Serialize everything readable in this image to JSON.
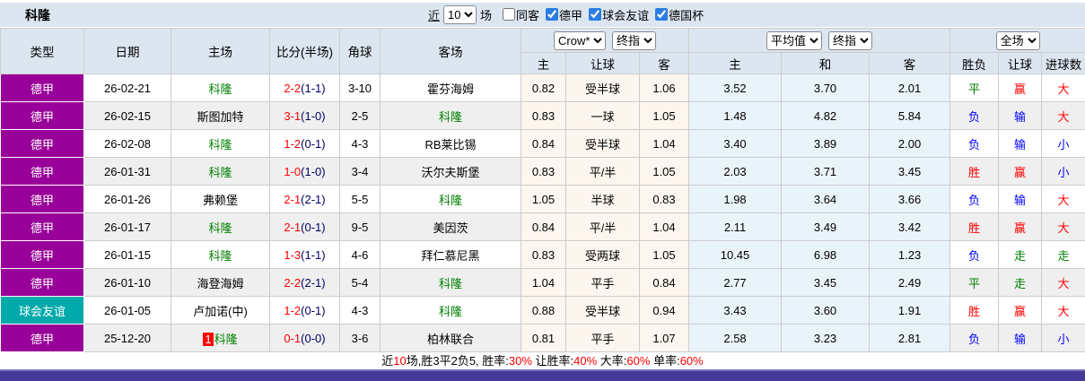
{
  "colors": {
    "bundesliga": "#990099",
    "friendly": "#00AAAA",
    "header_bg": "#dce6f1",
    "cream": "#fdf6ee",
    "light_blue": "#e9f3fa",
    "stripe": "#efefef",
    "red": "#ff0000",
    "blue": "#0000ff",
    "green": "#008000",
    "half_navy": "#000066",
    "checkbox_blue": "#2a7de1",
    "bar_purple": "#45399a"
  },
  "title": "科隆",
  "filter": {
    "near_label": "近",
    "count_value": "10",
    "count_suffix": "场",
    "checkboxes": [
      {
        "label": "同客",
        "checked": false
      },
      {
        "label": "德甲",
        "checked": true
      },
      {
        "label": "球会友谊",
        "checked": true
      },
      {
        "label": "德国杯",
        "checked": true
      }
    ]
  },
  "header": {
    "type": "类型",
    "date": "日期",
    "home": "主场",
    "score": "比分(半场)",
    "corner": "角球",
    "away": "客场",
    "selects": {
      "bookmaker": "Crow*",
      "odds_stage": "终指",
      "average": "平均值",
      "avg_stage": "终指",
      "scope": "全场"
    },
    "sub": {
      "home": "主",
      "handicap": "让球",
      "away": "客",
      "avg_home": "主",
      "avg_draw": "和",
      "avg_away": "客",
      "result": "胜负",
      "handicap_result": "让球",
      "goals": "进球数"
    }
  },
  "rows": [
    {
      "league": "德甲",
      "league_key": "bundesliga",
      "date": "26-02-21",
      "home": {
        "name": "科隆",
        "team": true
      },
      "score": {
        "ft": "2-2",
        "ht": "(1-1)"
      },
      "corners": "3-10",
      "away": {
        "name": "霍芬海姆",
        "team": false
      },
      "crown": [
        "0.82",
        "受半球",
        "1.06"
      ],
      "avg": [
        "3.52",
        "3.70",
        "2.01"
      ],
      "outcome": [
        {
          "t": "平",
          "c": "green"
        },
        {
          "t": "赢",
          "c": "red"
        },
        {
          "t": "大",
          "c": "red"
        }
      ]
    },
    {
      "league": "德甲",
      "league_key": "bundesliga",
      "date": "26-02-15",
      "home": {
        "name": "斯图加特",
        "team": false
      },
      "score": {
        "ft": "3-1",
        "ht": "(1-0)"
      },
      "corners": "2-5",
      "away": {
        "name": "科隆",
        "team": true
      },
      "crown": [
        "0.83",
        "一球",
        "1.05"
      ],
      "avg": [
        "1.48",
        "4.82",
        "5.84"
      ],
      "outcome": [
        {
          "t": "负",
          "c": "blue"
        },
        {
          "t": "输",
          "c": "blue"
        },
        {
          "t": "大",
          "c": "red"
        }
      ]
    },
    {
      "league": "德甲",
      "league_key": "bundesliga",
      "date": "26-02-08",
      "home": {
        "name": "科隆",
        "team": true
      },
      "score": {
        "ft": "1-2",
        "ht": "(0-1)"
      },
      "corners": "4-3",
      "away": {
        "name": "RB莱比锡",
        "team": false
      },
      "crown": [
        "0.84",
        "受半球",
        "1.04"
      ],
      "avg": [
        "3.40",
        "3.89",
        "2.00"
      ],
      "outcome": [
        {
          "t": "负",
          "c": "blue"
        },
        {
          "t": "输",
          "c": "blue"
        },
        {
          "t": "小",
          "c": "blue"
        }
      ]
    },
    {
      "league": "德甲",
      "league_key": "bundesliga",
      "date": "26-01-31",
      "home": {
        "name": "科隆",
        "team": true
      },
      "score": {
        "ft": "1-0",
        "ht": "(1-0)"
      },
      "corners": "3-4",
      "away": {
        "name": "沃尔夫斯堡",
        "team": false
      },
      "crown": [
        "0.83",
        "平/半",
        "1.05"
      ],
      "avg": [
        "2.03",
        "3.71",
        "3.45"
      ],
      "outcome": [
        {
          "t": "胜",
          "c": "red"
        },
        {
          "t": "赢",
          "c": "red"
        },
        {
          "t": "小",
          "c": "blue"
        }
      ]
    },
    {
      "league": "德甲",
      "league_key": "bundesliga",
      "date": "26-01-26",
      "home": {
        "name": "弗赖堡",
        "team": false
      },
      "score": {
        "ft": "2-1",
        "ht": "(2-1)"
      },
      "corners": "5-5",
      "away": {
        "name": "科隆",
        "team": true
      },
      "crown": [
        "1.05",
        "半球",
        "0.83"
      ],
      "avg": [
        "1.98",
        "3.64",
        "3.66"
      ],
      "outcome": [
        {
          "t": "负",
          "c": "blue"
        },
        {
          "t": "输",
          "c": "blue"
        },
        {
          "t": "大",
          "c": "red"
        }
      ]
    },
    {
      "league": "德甲",
      "league_key": "bundesliga",
      "date": "26-01-17",
      "home": {
        "name": "科隆",
        "team": true
      },
      "score": {
        "ft": "2-1",
        "ht": "(0-1)"
      },
      "corners": "9-5",
      "away": {
        "name": "美因茨",
        "team": false
      },
      "crown": [
        "0.84",
        "平/半",
        "1.04"
      ],
      "avg": [
        "2.11",
        "3.49",
        "3.42"
      ],
      "outcome": [
        {
          "t": "胜",
          "c": "red"
        },
        {
          "t": "赢",
          "c": "red"
        },
        {
          "t": "大",
          "c": "red"
        }
      ]
    },
    {
      "league": "德甲",
      "league_key": "bundesliga",
      "date": "26-01-15",
      "home": {
        "name": "科隆",
        "team": true
      },
      "score": {
        "ft": "1-3",
        "ht": "(1-1)"
      },
      "corners": "4-6",
      "away": {
        "name": "拜仁慕尼黑",
        "team": false
      },
      "crown": [
        "0.83",
        "受两球",
        "1.05"
      ],
      "avg": [
        "10.45",
        "6.98",
        "1.23"
      ],
      "outcome": [
        {
          "t": "负",
          "c": "blue"
        },
        {
          "t": "走",
          "c": "green"
        },
        {
          "t": "走",
          "c": "green"
        }
      ]
    },
    {
      "league": "德甲",
      "league_key": "bundesliga",
      "date": "26-01-10",
      "home": {
        "name": "海登海姆",
        "team": false
      },
      "score": {
        "ft": "2-2",
        "ht": "(2-1)"
      },
      "corners": "5-4",
      "away": {
        "name": "科隆",
        "team": true
      },
      "crown": [
        "1.04",
        "平手",
        "0.84"
      ],
      "avg": [
        "2.77",
        "3.45",
        "2.49"
      ],
      "outcome": [
        {
          "t": "平",
          "c": "green"
        },
        {
          "t": "走",
          "c": "green"
        },
        {
          "t": "大",
          "c": "red"
        }
      ]
    },
    {
      "league": "球会友谊",
      "league_key": "friendly",
      "date": "26-01-05",
      "home": {
        "name": "卢加诺(中)",
        "team": false
      },
      "score": {
        "ft": "1-2",
        "ht": "(0-1)"
      },
      "corners": "4-3",
      "away": {
        "name": "科隆",
        "team": true
      },
      "crown": [
        "0.88",
        "受半球",
        "0.94"
      ],
      "avg": [
        "3.43",
        "3.60",
        "1.91"
      ],
      "outcome": [
        {
          "t": "胜",
          "c": "red"
        },
        {
          "t": "赢",
          "c": "red"
        },
        {
          "t": "大",
          "c": "red"
        }
      ]
    },
    {
      "league": "德甲",
      "league_key": "bundesliga",
      "date": "25-12-20",
      "home": {
        "name": "科隆",
        "team": true,
        "badge": "1"
      },
      "score": {
        "ft": "0-1",
        "ht": "(0-0)"
      },
      "corners": "3-6",
      "away": {
        "name": "柏林联合",
        "team": false
      },
      "crown": [
        "0.81",
        "平手",
        "1.07"
      ],
      "avg": [
        "2.58",
        "3.23",
        "2.81"
      ],
      "outcome": [
        {
          "t": "负",
          "c": "blue"
        },
        {
          "t": "输",
          "c": "blue"
        },
        {
          "t": "小",
          "c": "blue"
        }
      ]
    }
  ],
  "summary": {
    "segments": [
      {
        "text": "近",
        "color": "#000000"
      },
      {
        "text": "10",
        "color": "#ff0000"
      },
      {
        "text": "场,胜3平2负5, 胜率:",
        "color": "#000000"
      },
      {
        "text": "30%",
        "color": "#ff0000"
      },
      {
        "text": " 让胜率:",
        "color": "#000000"
      },
      {
        "text": "40%",
        "color": "#ff0000"
      },
      {
        "text": " 大率:",
        "color": "#000000"
      },
      {
        "text": "60%",
        "color": "#ff0000"
      },
      {
        "text": " 单率:",
        "color": "#000000"
      },
      {
        "text": "60%",
        "color": "#ff0000"
      }
    ]
  }
}
